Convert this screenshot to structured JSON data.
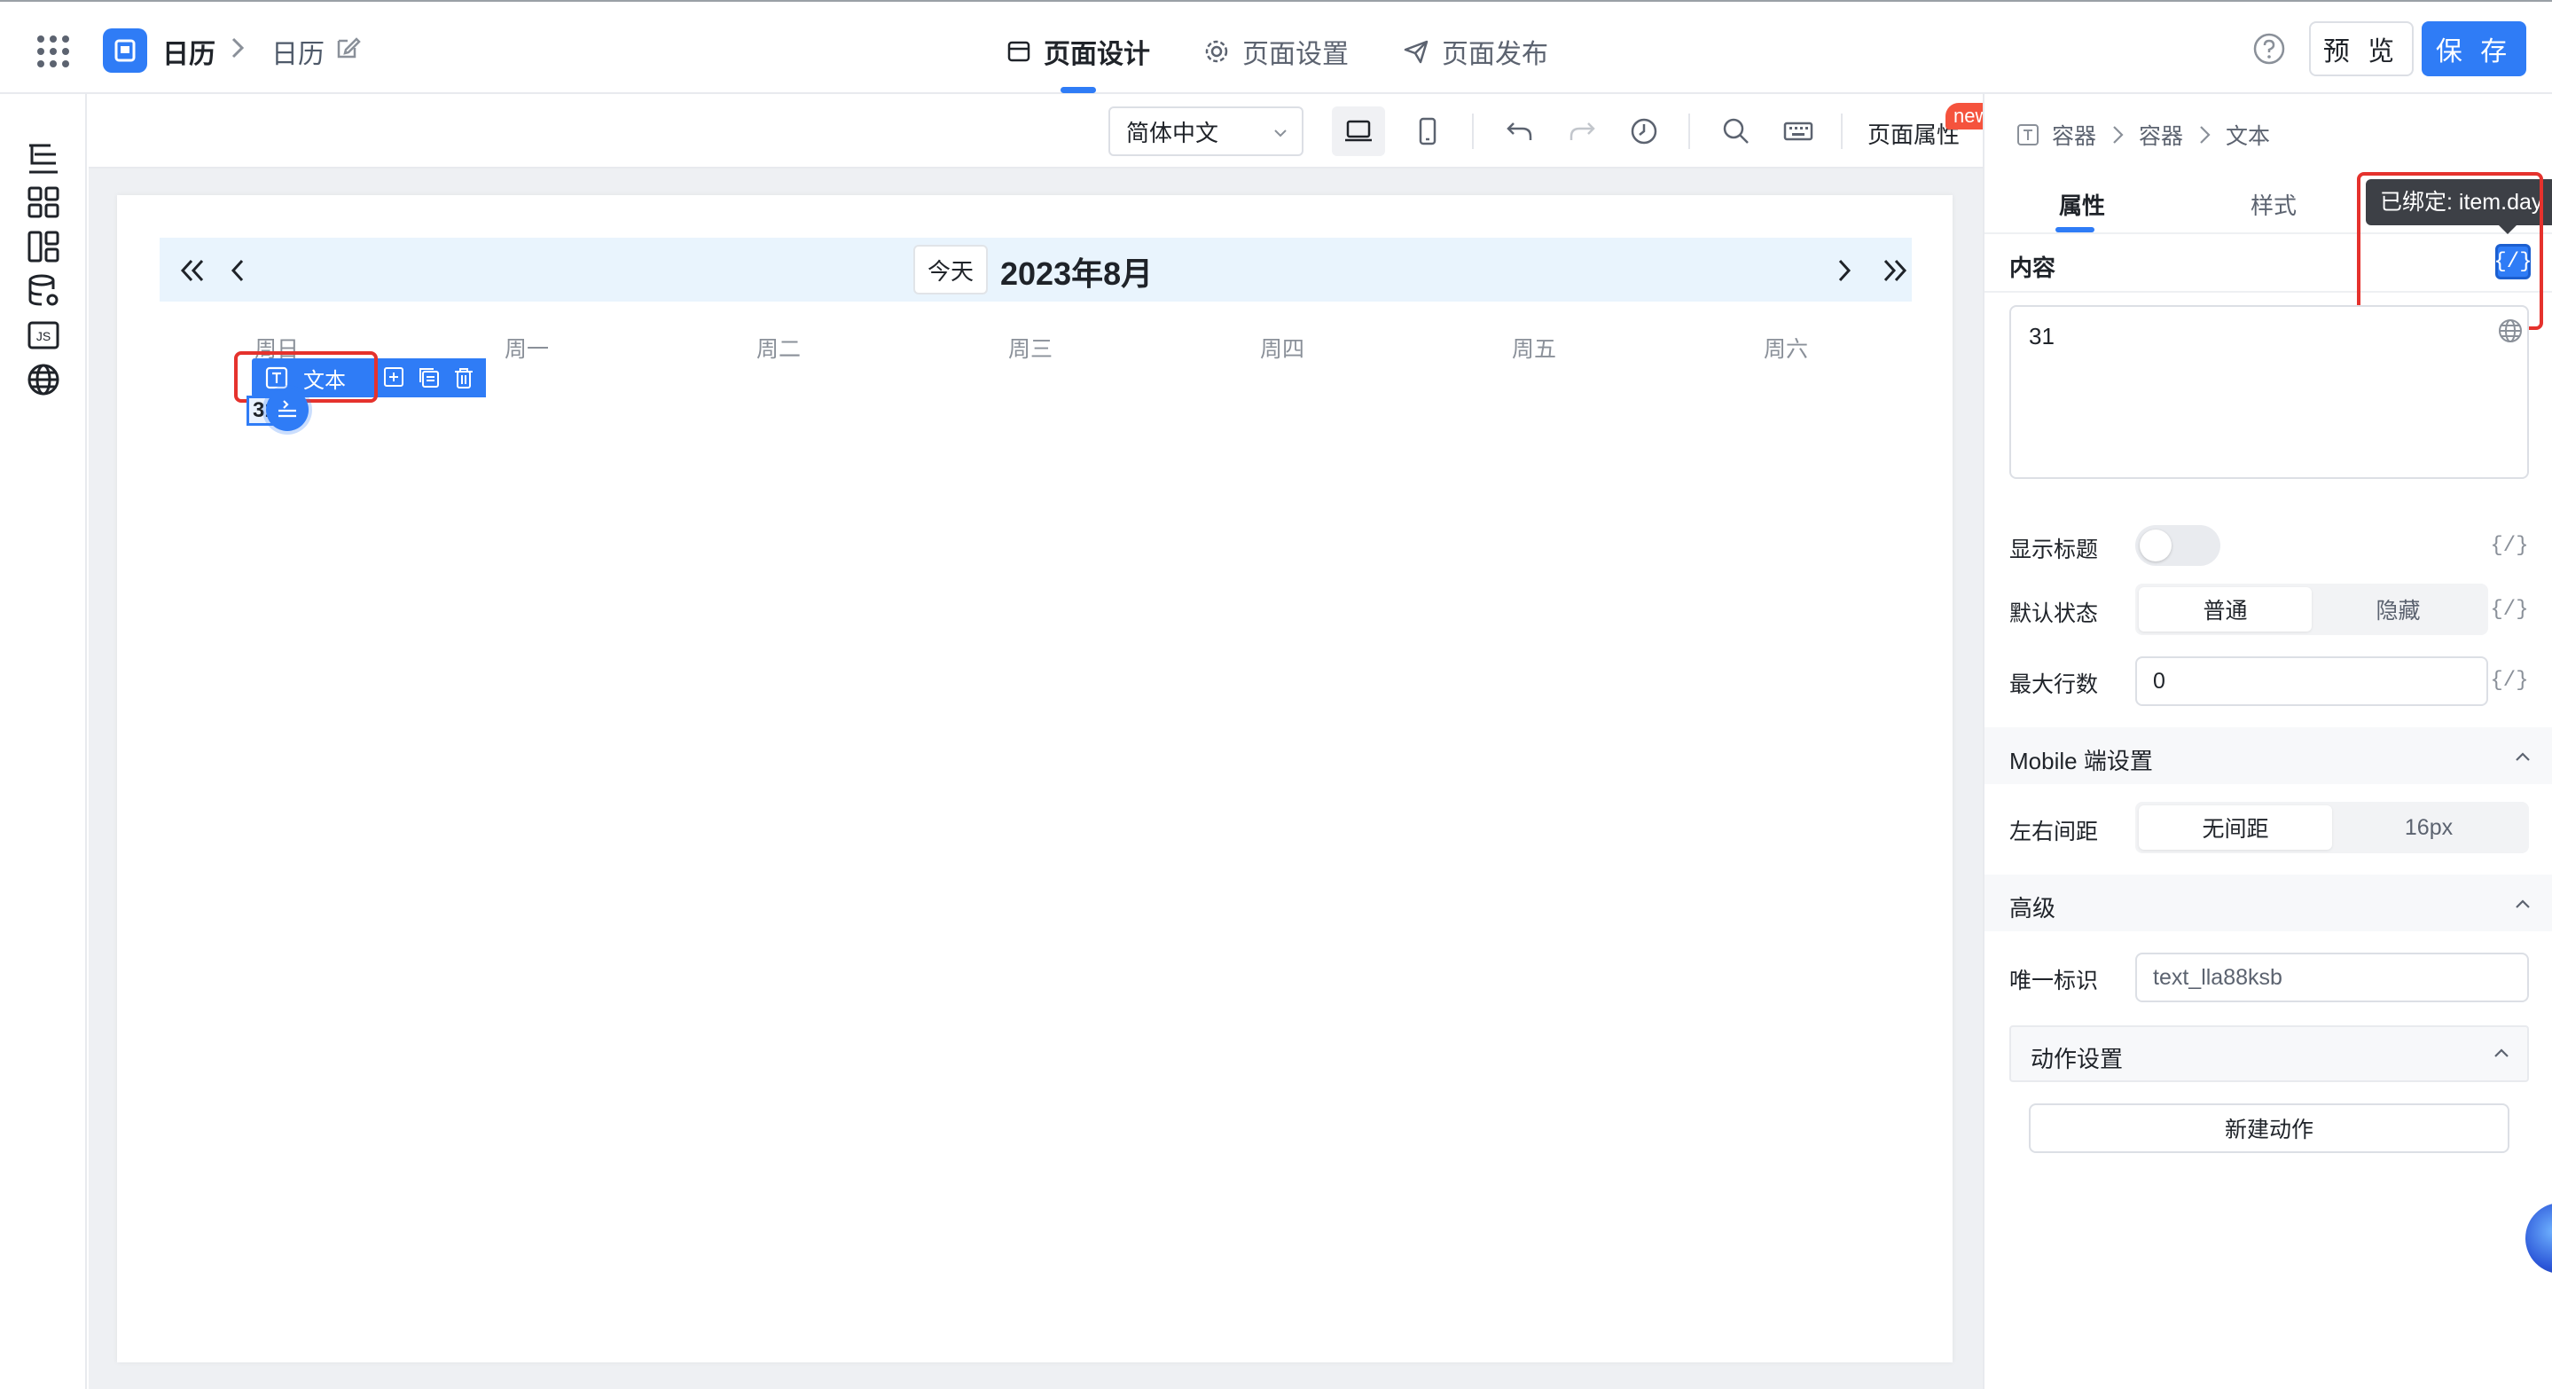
{
  "header": {
    "app_name": "日历",
    "page_name": "日历",
    "tabs": [
      {
        "label": "页面设计",
        "active": true
      },
      {
        "label": "页面设置",
        "active": false
      },
      {
        "label": "页面发布",
        "active": false
      }
    ],
    "preview_label": "预 览",
    "save_label": "保 存"
  },
  "toolbar": {
    "language": "简体中文",
    "page_props_label": "页面属性",
    "new_badge": "new"
  },
  "calendar": {
    "today_label": "今天",
    "month_title": "2023年8月",
    "weekdays": [
      "周日",
      "周一",
      "周二",
      "周三",
      "周四",
      "周五",
      "周六"
    ],
    "selected_component_label": "文本",
    "selected_day_text": "31"
  },
  "right_panel": {
    "breadcrumb": [
      "容器",
      "容器",
      "文本"
    ],
    "tabs": [
      {
        "label": "属性",
        "active": true
      },
      {
        "label": "样式",
        "active": false
      }
    ],
    "tooltip": "已绑定: item.day",
    "bind_symbol": "{/}",
    "content_section": {
      "title": "内容",
      "value": "31"
    },
    "show_title": {
      "label": "显示标题",
      "enabled": false
    },
    "default_state": {
      "label": "默认状态",
      "options": [
        "普通",
        "隐藏"
      ],
      "selected": "普通"
    },
    "max_lines": {
      "label": "最大行数",
      "value": "0"
    },
    "mobile_section": {
      "title": "Mobile 端设置",
      "padding_label": "左右间距",
      "options": [
        "无间距",
        "16px"
      ],
      "selected": "无间距"
    },
    "advanced_section": {
      "title": "高级",
      "uid_label": "唯一标识",
      "uid_value": "text_lla88ksb"
    },
    "actions_section": {
      "title": "动作设置",
      "new_action_label": "新建动作"
    }
  },
  "colors": {
    "accent": "#2f7cf6",
    "highlight_box": "#e5322d",
    "badge": "#f5533d",
    "calendar_header_bg": "#e9f4fd"
  }
}
